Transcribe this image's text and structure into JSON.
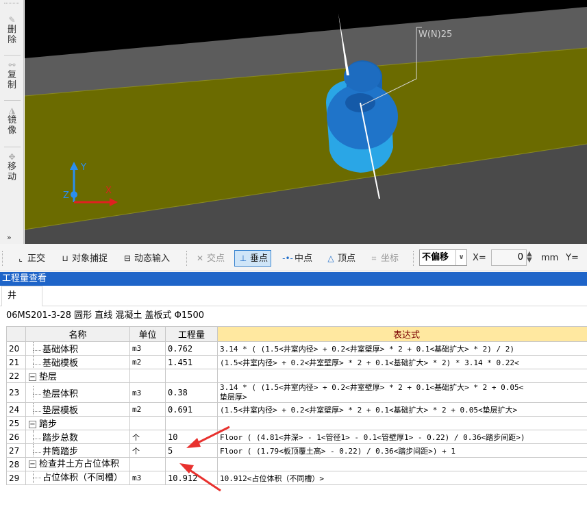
{
  "left_toolbar": {
    "items": [
      {
        "label": "删除",
        "icon": "eraser-icon"
      },
      {
        "label": "复制",
        "icon": "copy-icon"
      },
      {
        "label": "镜像",
        "icon": "mirror-icon"
      },
      {
        "label": "移动",
        "icon": "move-icon"
      }
    ],
    "more_icon": "chevron-double-down-icon"
  },
  "viewport": {
    "label": "W(N)25",
    "axis_y": "Y",
    "axis_x": "X",
    "axis_z": "Z",
    "colors": {
      "background": "#000000",
      "slab": "#5a5a5a",
      "beam": "#6b6b00",
      "manhole": "#1f74c9"
    }
  },
  "snap_toolbar": {
    "ortho": "正交",
    "object_snap": "对象捕捉",
    "dynamic_input": "动态输入",
    "intersection": "交点",
    "perpendicular": "垂点",
    "midpoint": "中点",
    "vertex": "顶点",
    "coordinate": "坐标",
    "offset_value": "不偏移",
    "x_label": "X=",
    "x_value": "0",
    "unit": "mm",
    "y_label": "Y="
  },
  "panel": {
    "title": "工程量查看",
    "tab": "井",
    "spec": "06MS201-3-28 圆形 直线 混凝土 盖板式 Φ1500"
  },
  "table": {
    "headers": {
      "name": "名称",
      "unit": "单位",
      "qty": "工程量",
      "expr": "表达式"
    },
    "rows": [
      {
        "num": "20",
        "name": "基础体积",
        "unit": "m3",
        "qty": "0.762",
        "expr": "3.14 * ( (1.5<井室内径> + 0.2<井室壁厚> * 2 + 0.1<基础扩大> * 2)  / 2)"
      },
      {
        "num": "21",
        "name": "基础模板",
        "unit": "m2",
        "qty": "1.451",
        "expr": " (1.5<井室内径> + 0.2<井室壁厚> * 2 + 0.1<基础扩大> * 2)  * 3.14 * 0.22<"
      },
      {
        "num": "22",
        "name": "垫层",
        "unit": "",
        "qty": "",
        "expr": ""
      },
      {
        "num": "23",
        "name": "垫层体积",
        "unit": "m3",
        "qty": "0.38",
        "expr": "3.14 * ( (1.5<井室内径> + 0.2<井室壁厚> * 2 + 0.1<基础扩大> * 2 + 0.05<",
        "expr2": "垫层厚>"
      },
      {
        "num": "24",
        "name": "垫层模板",
        "unit": "m2",
        "qty": "0.691",
        "expr": " (1.5<井室内径> + 0.2<井室壁厚> * 2 + 0.1<基础扩大> * 2 + 0.05<垫层扩大>"
      },
      {
        "num": "25",
        "name": "踏步",
        "unit": "",
        "qty": "",
        "expr": ""
      },
      {
        "num": "26",
        "name": "踏步总数",
        "unit": "个",
        "qty": "10",
        "expr": "Floor ( (4.81<井深> - 1<管径1> - 0.1<管壁厚1> - 0.22)  / 0.36<踏步间距>)"
      },
      {
        "num": "27",
        "name": "井筒踏步",
        "unit": "个",
        "qty": "5",
        "expr": "Floor ( (1.79<板顶覆土高> - 0.22)  / 0.36<踏步间距>)  + 1"
      },
      {
        "num": "28",
        "name": "检查井土方占位体积",
        "unit": "",
        "qty": "",
        "expr": ""
      },
      {
        "num": "29",
        "name": "占位体积（不同槽）",
        "unit": "m3",
        "qty": "10.912",
        "expr": "10.912<占位体积（不同槽）>"
      }
    ]
  }
}
